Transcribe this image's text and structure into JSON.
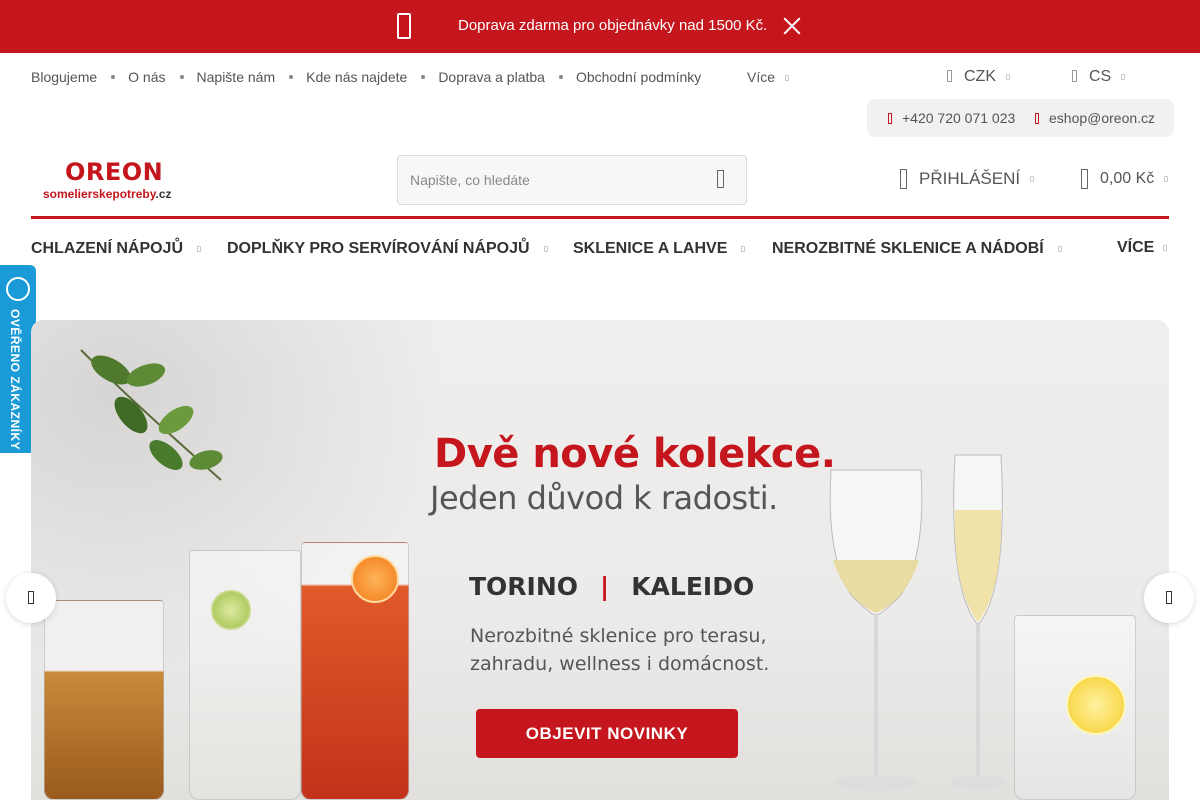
{
  "promo": {
    "text": "Doprava zdarma pro objednávky nad 1500 Kč.",
    "icon": "truck-icon",
    "close_icon": "close-icon"
  },
  "top_links": [
    {
      "label": "Blogujeme"
    },
    {
      "label": "O nás"
    },
    {
      "label": "Napište nám"
    },
    {
      "label": "Kde nás najdete"
    },
    {
      "label": "Doprava a platba"
    },
    {
      "label": "Obchodní podmínky"
    }
  ],
  "more_label": "Více",
  "currency": "CZK",
  "language": "CS",
  "contact": {
    "phone": "+420 720 071 023",
    "email": "eshop@oreon.cz"
  },
  "logo": {
    "brand": "OREON",
    "sub_red": "somelierskepotreby",
    "sub_domain": ".cz"
  },
  "search": {
    "placeholder": "Napište, co hledáte"
  },
  "account": {
    "login_label": "PŘIHLÁŠENÍ",
    "cart_total": "0,00 Kč"
  },
  "categories": [
    {
      "label": "CHLAZENÍ NÁPOJŮ"
    },
    {
      "label": "DOPLŇKY PRO SERVÍROVÁNÍ NÁPOJŮ"
    },
    {
      "label": "SKLENICE A LAHVE"
    },
    {
      "label": "NEROZBITNÉ SKLENICE A NÁDOBÍ"
    },
    {
      "label": "VÍCE"
    }
  ],
  "verified_badge": {
    "text": "OVĚŘENO ZÁKAZNÍKY"
  },
  "hero": {
    "title": "Dvě nové kolekce.",
    "subtitle": "Jeden důvod k radosti.",
    "collection_a": "TORINO",
    "collection_sep": "|",
    "collection_b": "KALEIDO",
    "desc_line1": "Nerozbitné sklenice pro terasu,",
    "desc_line2": "zahradu, wellness i domácnost.",
    "cta": "OBJEVIT NOVINKY"
  },
  "colors": {
    "brand_red": "#c4161c",
    "badge_blue": "#1a9bd7"
  }
}
